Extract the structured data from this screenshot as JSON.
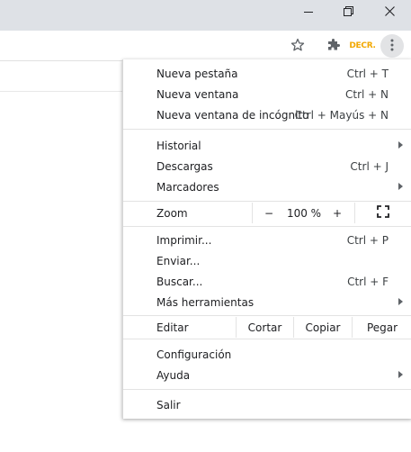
{
  "window": {
    "minimize_icon": "minimize-icon",
    "restore_icon": "restore-icon",
    "close_icon": "close-icon"
  },
  "toolbar": {
    "bookmark_icon": "star-icon",
    "extensions_icon": "puzzle-icon",
    "extension_badge": "DECR.",
    "menu_icon": "vertical-dots-icon"
  },
  "menu": {
    "new_tab": {
      "label": "Nueva pestaña",
      "shortcut": "Ctrl + T"
    },
    "new_window": {
      "label": "Nueva ventana",
      "shortcut": "Ctrl + N"
    },
    "incognito": {
      "label": "Nueva ventana de incógnito",
      "shortcut": "Ctrl + Mayús + N"
    },
    "history": {
      "label": "Historial"
    },
    "downloads": {
      "label": "Descargas",
      "shortcut": "Ctrl + J"
    },
    "bookmarks": {
      "label": "Marcadores"
    },
    "zoom": {
      "label": "Zoom",
      "minus": "−",
      "value": "100 %",
      "plus": "+",
      "fullscreen_icon": "fullscreen-icon"
    },
    "print": {
      "label": "Imprimir...",
      "shortcut": "Ctrl + P"
    },
    "send": {
      "label": "Enviar..."
    },
    "find": {
      "label": "Buscar...",
      "shortcut": "Ctrl + F"
    },
    "more_tools": {
      "label": "Más herramientas"
    },
    "edit": {
      "label": "Editar",
      "cut": "Cortar",
      "copy": "Copiar",
      "paste": "Pegar"
    },
    "settings": {
      "label": "Configuración"
    },
    "help": {
      "label": "Ayuda"
    },
    "exit": {
      "label": "Salir"
    }
  },
  "colors": {
    "titlebar": "#dee1e6",
    "menu_bg": "#ffffff",
    "text": "#202124",
    "badge": "#f2a800"
  }
}
